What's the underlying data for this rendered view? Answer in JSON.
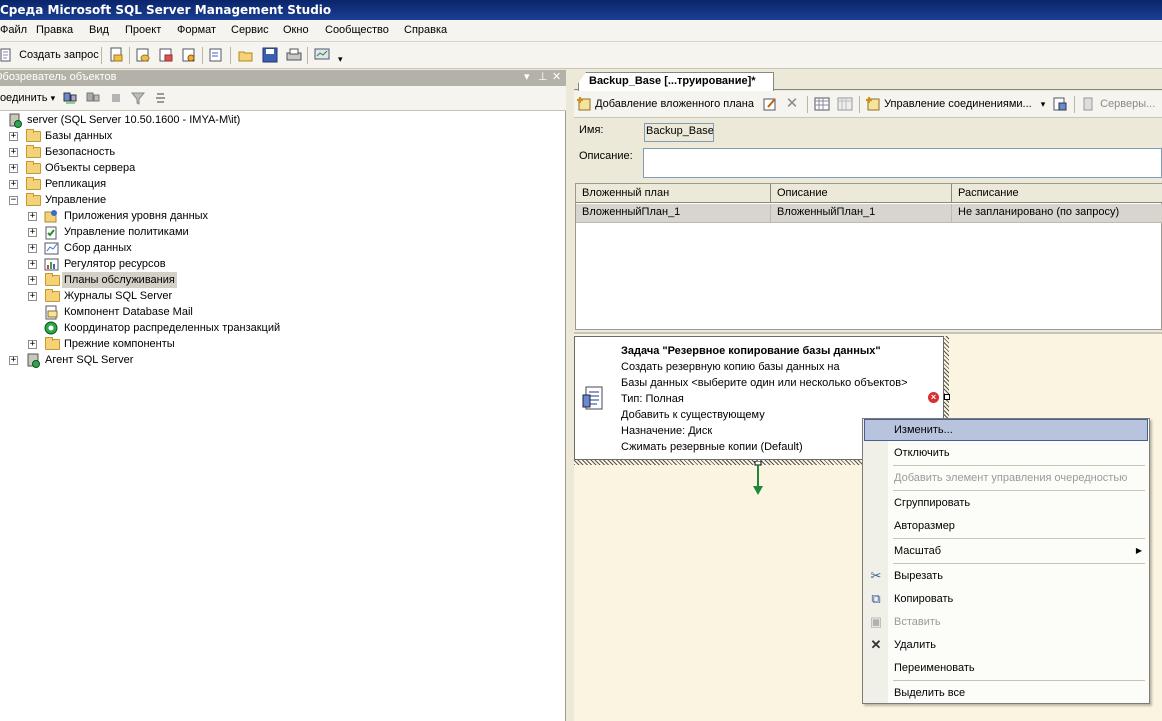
{
  "window": {
    "title": "Среда Microsoft SQL Server Management Studio"
  },
  "menu": [
    "Файл",
    "Правка",
    "Вид",
    "Проект",
    "Формат",
    "Сервис",
    "Окно",
    "Сообщество",
    "Справка"
  ],
  "toolbar": {
    "new_query": "Создать запрос"
  },
  "object_explorer": {
    "title": "Обозреватель объектов",
    "pane_buttons": [
      "▾",
      "⊥",
      "✕"
    ],
    "connect": "Соединить",
    "tree": [
      {
        "label": "server (SQL Server 10.50.1600 - IMYA-M\\it)",
        "level": 0,
        "icon": "server-icon",
        "expander": ""
      },
      {
        "label": "Базы данных",
        "level": 1,
        "icon": "folder-icon",
        "expander": "+"
      },
      {
        "label": "Безопасность",
        "level": 1,
        "icon": "folder-icon",
        "expander": "+"
      },
      {
        "label": "Объекты сервера",
        "level": 1,
        "icon": "folder-icon",
        "expander": "+"
      },
      {
        "label": "Репликация",
        "level": 1,
        "icon": "folder-icon",
        "expander": "+"
      },
      {
        "label": "Управление",
        "level": 1,
        "icon": "folder-icon",
        "expander": "−"
      },
      {
        "label": "Приложения уровня данных",
        "level": 2,
        "icon": "data-app-icon",
        "expander": "+"
      },
      {
        "label": "Управление политиками",
        "level": 2,
        "icon": "policy-icon",
        "expander": "+"
      },
      {
        "label": "Сбор данных",
        "level": 2,
        "icon": "data-collection-icon",
        "expander": "+"
      },
      {
        "label": "Регулятор ресурсов",
        "level": 2,
        "icon": "resource-governor-icon",
        "expander": "+"
      },
      {
        "label": "Планы обслуживания",
        "level": 2,
        "icon": "folder-icon",
        "expander": "+",
        "selected": true
      },
      {
        "label": "Журналы SQL Server",
        "level": 2,
        "icon": "folder-icon",
        "expander": "+"
      },
      {
        "label": "Компонент Database Mail",
        "level": 2,
        "icon": "mail-icon",
        "expander": ""
      },
      {
        "label": "Координатор распределенных транзакций",
        "level": 2,
        "icon": "dtc-icon",
        "expander": ""
      },
      {
        "label": "Прежние компоненты",
        "level": 2,
        "icon": "folder-icon",
        "expander": "+"
      },
      {
        "label": "Агент SQL Server",
        "level": 1,
        "icon": "agent-icon",
        "expander": "+"
      }
    ]
  },
  "document": {
    "tab_title": "Backup_Base [...труирование]*",
    "toolbar": {
      "add_subplan": "Добавление вложенного плана",
      "manage_connections": "Управление соединениями...",
      "servers": "Серверы..."
    },
    "name_label": "Имя:",
    "name_value": "Backup_Base",
    "description_label": "Описание:",
    "grid": {
      "headers": [
        "Вложенный план",
        "Описание",
        "Расписание"
      ],
      "rows": [
        [
          "ВложенныйПлан_1",
          "ВложенныйПлан_1",
          "Не запланировано (по запросу)"
        ]
      ]
    },
    "task": {
      "title": "Задача \"Резервное копирование базы данных\"",
      "lines": [
        "Создать резервную копию базы данных на",
        "Базы данных <выберите один или несколько объектов>",
        "Тип: Полная",
        "Добавить к существующему",
        "Назначение: Диск",
        "Сжимать резервные копии (Default)"
      ]
    }
  },
  "context_menu": {
    "items": [
      {
        "label": "Изменить...",
        "highlighted": true
      },
      {
        "label": "Отключить"
      },
      {
        "label": "Добавить элемент управления очередностью",
        "disabled": true
      },
      {
        "label": "Сгруппировать"
      },
      {
        "label": "Авторазмер"
      },
      {
        "label": "Масштаб",
        "submenu": "▶"
      },
      {
        "label": "Вырезать",
        "icon": "✂"
      },
      {
        "label": "Копировать",
        "icon": "⧉"
      },
      {
        "label": "Вставить",
        "icon": "▣",
        "disabled": true
      },
      {
        "label": "Удалить",
        "icon": "✕"
      },
      {
        "label": "Переименовать"
      },
      {
        "label": "Выделить все"
      }
    ]
  }
}
